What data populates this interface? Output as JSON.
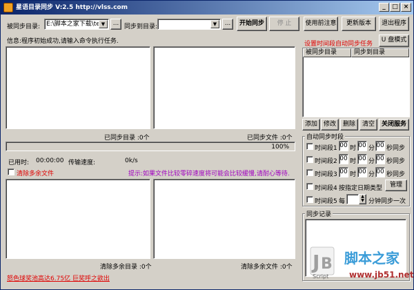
{
  "window": {
    "title": "星语目录同步 V:2.5 http://vlss.com",
    "min": "_",
    "max": "□",
    "close": "×"
  },
  "toolbar": {
    "source_label": "被同步目录:",
    "source_value": "E:\\脚本之家下载\\tes",
    "browse": "...",
    "target_label": "同步到目录:",
    "target_value": "",
    "start": "开始同步",
    "stop": "停 止"
  },
  "right_buttons": {
    "notes": "使用前注意",
    "update": "更新版本",
    "exit": "退出程序"
  },
  "info": {
    "label": "信息:程序初始成功,请输入命令执行任务."
  },
  "left": {
    "synced_dirs": "已同步目录 :0个",
    "synced_files": "已同步文件 :0个",
    "progress": "100%",
    "elapsed_label": "已用时:",
    "elapsed_value": "00:00:00",
    "speed_label": "传输速度:",
    "speed_value": "0k/s",
    "clear_extra_label": "清除多余文件",
    "hint": "提示:如果文件比较零碎速度将可能会比较缓慢,请耐心等待.",
    "cleared_dirs": "清除多余目录 :0个",
    "cleared_files": "清除多余文件 :0个",
    "footer_link": "怒色球奖池高达6.75亿 巨奖呼之欲出"
  },
  "schedule": {
    "title": "设置时间段自动同步任务",
    "umode": "U 盘模式",
    "col_source": "被同步目录",
    "col_target": "同步到目录",
    "add": "添加",
    "edit": "修改",
    "delete": "删除",
    "clear": "清空",
    "close_service": "关闭服务",
    "group_title": "自动同步时段",
    "slots": [
      {
        "label": "时间段1",
        "h": "00",
        "m": "00",
        "s": "00",
        "unit_h": "时",
        "unit_m": "分",
        "unit_s": "秒同步"
      },
      {
        "label": "时间段2",
        "h": "00",
        "m": "00",
        "s": "00",
        "unit_h": "时",
        "unit_m": "分",
        "unit_s": "秒同步"
      },
      {
        "label": "时间段3",
        "h": "00",
        "m": "00",
        "s": "00",
        "unit_h": "时",
        "unit_m": "分",
        "unit_s": "秒同步"
      }
    ],
    "slot4_label": "时间段4",
    "slot4_desc": "按指定日期类型",
    "manage": "管理",
    "slot5_label": "时间段5",
    "slot5_every": "每",
    "slot5_value": "",
    "slot5_desc": "分钟同步一次",
    "log_title": "同步记录"
  },
  "watermark": {
    "text": "脚本之家",
    "url": "www.jb51.net",
    "script": "Script"
  },
  "colors": {
    "title_start": "#0a246a",
    "title_end": "#a6caf0",
    "red": "#e00000",
    "purple": "#a000c0"
  }
}
